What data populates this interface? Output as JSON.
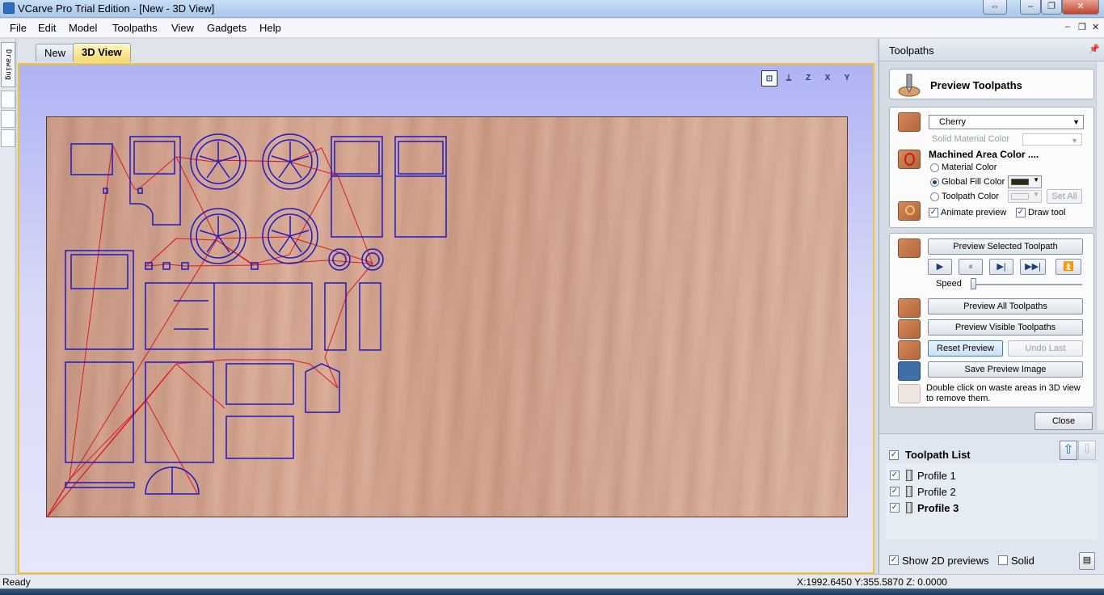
{
  "window": {
    "title": "VCarve Pro Trial Edition - [New - 3D View]",
    "buttons": {
      "restore_switch": "⇔",
      "minimize": "–",
      "maximize": "❐",
      "close": "✕"
    }
  },
  "menu": {
    "items": [
      "File",
      "Edit",
      "Model",
      "Toolpaths",
      "View",
      "Gadgets",
      "Help"
    ],
    "mdi_controls": [
      "–",
      "❐",
      "✕"
    ]
  },
  "left_strip": {
    "tab_label": "Drawing"
  },
  "doc_tabs": [
    {
      "label": "New",
      "active": false
    },
    {
      "label": "3D View",
      "active": true
    }
  ],
  "view_toolbar": {
    "icons": [
      "zoom-extents-icon",
      "iso-view-icon",
      "z-view-icon",
      "x-view-icon",
      "y-view-icon"
    ],
    "labels": [
      "",
      "",
      "Z",
      "X",
      "Y"
    ]
  },
  "material": {
    "name": "Cherry",
    "color": "#d6a690"
  },
  "toolpath_color": "#1a1acc",
  "rapid_color": "#dd1a1a",
  "panel": {
    "header": "Toolpaths",
    "pin": "📌",
    "preview_title": "Preview Toolpaths",
    "material_select": "Cherry",
    "solid_material_color_label": "Solid Material Color",
    "machined_area_label": "Machined Area Color ....",
    "radio_material": "Material Color",
    "radio_global": "Global Fill Color",
    "radio_toolpath": "Toolpath Color",
    "radio_selected": "Global Fill Color",
    "global_fill_swatch": "#2b2b14",
    "set_all": "Set All",
    "animate_preview": "Animate preview",
    "animate_checked": true,
    "draw_tool": "Draw tool",
    "draw_tool_checked": true,
    "preview_selected": "Preview Selected Toolpath",
    "playback": [
      "▶",
      "⏸",
      "▶|",
      "▶▶|",
      "⏫"
    ],
    "speed_label": "Speed",
    "speed_value": 0.0,
    "preview_all": "Preview All Toolpaths",
    "preview_visible": "Preview Visible Toolpaths",
    "reset_preview": "Reset Preview",
    "undo_last": "Undo Last",
    "save_preview_image": "Save Preview Image",
    "hint": "Double click on waste areas in 3D view to remove them.",
    "close": "Close"
  },
  "toolpath_list": {
    "title": "Toolpath List",
    "title_checked": true,
    "up_arrow": "⇧",
    "down_arrow": "⇩",
    "items": [
      {
        "label": "Profile 1",
        "checked": true,
        "bold": false
      },
      {
        "label": "Profile 2",
        "checked": true,
        "bold": false
      },
      {
        "label": "Profile 3",
        "checked": true,
        "bold": true
      }
    ],
    "show_2d_previews": "Show 2D previews",
    "show_2d_checked": true,
    "solid": "Solid",
    "solid_checked": false
  },
  "status": {
    "left": "Ready",
    "coords": "X:1992.6450 Y:355.5870 Z:  0.0000"
  }
}
